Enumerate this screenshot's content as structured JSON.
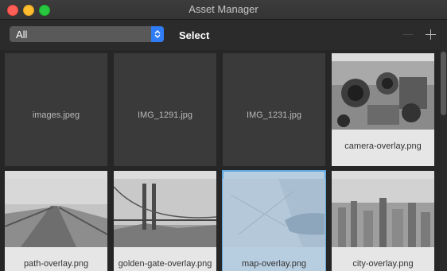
{
  "window": {
    "title": "Asset Manager"
  },
  "toolbar": {
    "filter_value": "All",
    "select_label": "Select"
  },
  "grid": {
    "row1": [
      {
        "name": "images.jpeg",
        "kind": "placeholder"
      },
      {
        "name": "IMG_1291.jpg",
        "kind": "placeholder"
      },
      {
        "name": "IMG_1231.jpg",
        "kind": "placeholder"
      },
      {
        "name": "camera-overlay.png",
        "kind": "image"
      }
    ],
    "row2": [
      {
        "name": "path-overlay.png",
        "kind": "image"
      },
      {
        "name": "golden-gate-overlay.png",
        "kind": "image"
      },
      {
        "name": "map-overlay.png",
        "kind": "image",
        "selected": true
      },
      {
        "name": "city-overlay.png",
        "kind": "image"
      }
    ]
  },
  "colors": {
    "accent": "#2f7df6",
    "selection": "#5fa6de",
    "window_bg": "#2a2a2a",
    "tile_bg": "#3a3a3a"
  }
}
